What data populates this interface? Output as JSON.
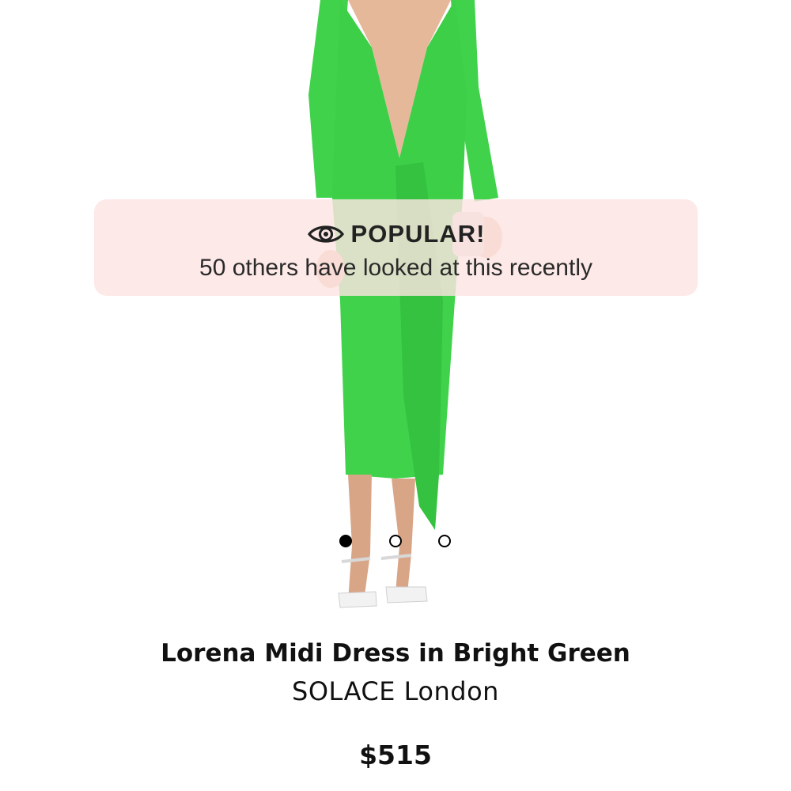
{
  "product": {
    "name": "Lorena Midi Dress in Bright Green",
    "brand": "SOLACE London",
    "price": "$515"
  },
  "banner": {
    "icon": "eye-icon",
    "title": "POPULAR!",
    "subtitle": "50 others have looked at this recently"
  },
  "carousel": {
    "total": 3,
    "active": 1
  },
  "colors": {
    "dress": "#3fd24a",
    "banner_bg": "#fce4e2",
    "text": "#111111"
  }
}
